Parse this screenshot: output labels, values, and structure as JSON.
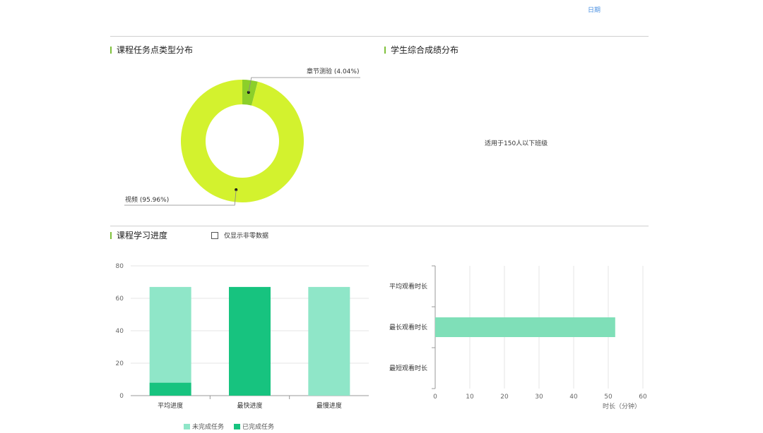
{
  "top_chart": {
    "xlabel": "日期"
  },
  "sections": {
    "task_type": "课程任务点类型分布",
    "grades": "学生综合成绩分布",
    "progress": "课程学习进度"
  },
  "grades_note": "适用于150人以下班级",
  "checkbox_label": "仅显示非零数据",
  "colors": {
    "accent": "#7fc13b",
    "video": "#d3f22e",
    "quiz": "#8ccf2a",
    "incomplete": "#8fe6c8",
    "complete": "#17c37f",
    "duration": "#7fdfb8"
  },
  "chart_data": [
    {
      "type": "pie",
      "title": "课程任务点类型分布",
      "donut": true,
      "slices": [
        {
          "label": "章节测验 (4.04%)",
          "value": 4.04
        },
        {
          "label": "视频 (95.96%)",
          "value": 95.96
        }
      ]
    },
    {
      "type": "bar",
      "stacked": true,
      "categories": [
        "平均进度",
        "最快进度",
        "最慢进度"
      ],
      "series": [
        {
          "name": "已完成任务",
          "values": [
            8,
            67,
            0
          ]
        },
        {
          "name": "未完成任务",
          "values": [
            59,
            0,
            67
          ]
        }
      ],
      "yticks": [
        0,
        20,
        40,
        60,
        80
      ],
      "ylim": [
        0,
        80
      ],
      "legend": [
        "未完成任务",
        "已完成任务"
      ],
      "legend_position": "bottom"
    },
    {
      "type": "bar",
      "orientation": "horizontal",
      "categories": [
        "平均观看时长",
        "最长观看时长",
        "最短观看时长"
      ],
      "values": [
        0,
        52,
        0
      ],
      "xticks": [
        0,
        10,
        20,
        30,
        40,
        50,
        60
      ],
      "xlim": [
        0,
        60
      ],
      "xlabel": "时长（分钟）"
    }
  ]
}
